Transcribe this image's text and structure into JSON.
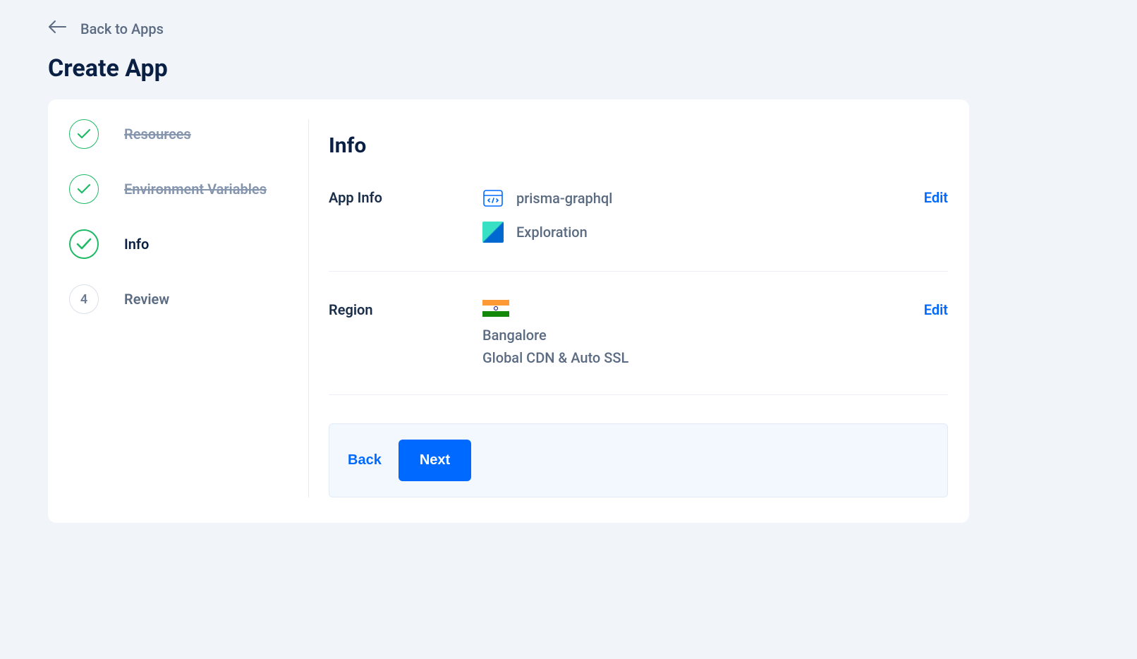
{
  "back_link": "Back to Apps",
  "page_title": "Create App",
  "steps": [
    {
      "label": "Resources",
      "status": "done"
    },
    {
      "label": "Environment Variables",
      "status": "done"
    },
    {
      "label": "Info",
      "status": "active"
    },
    {
      "number": "4",
      "label": "Review",
      "status": "pending"
    }
  ],
  "main": {
    "title": "Info",
    "app_info": {
      "heading": "App Info",
      "app_name": "prisma-graphql",
      "project_name": "Exploration",
      "edit": "Edit"
    },
    "region": {
      "heading": "Region",
      "city": "Bangalore",
      "subtitle": "Global CDN & Auto SSL",
      "edit": "Edit"
    },
    "buttons": {
      "back": "Back",
      "next": "Next"
    }
  }
}
